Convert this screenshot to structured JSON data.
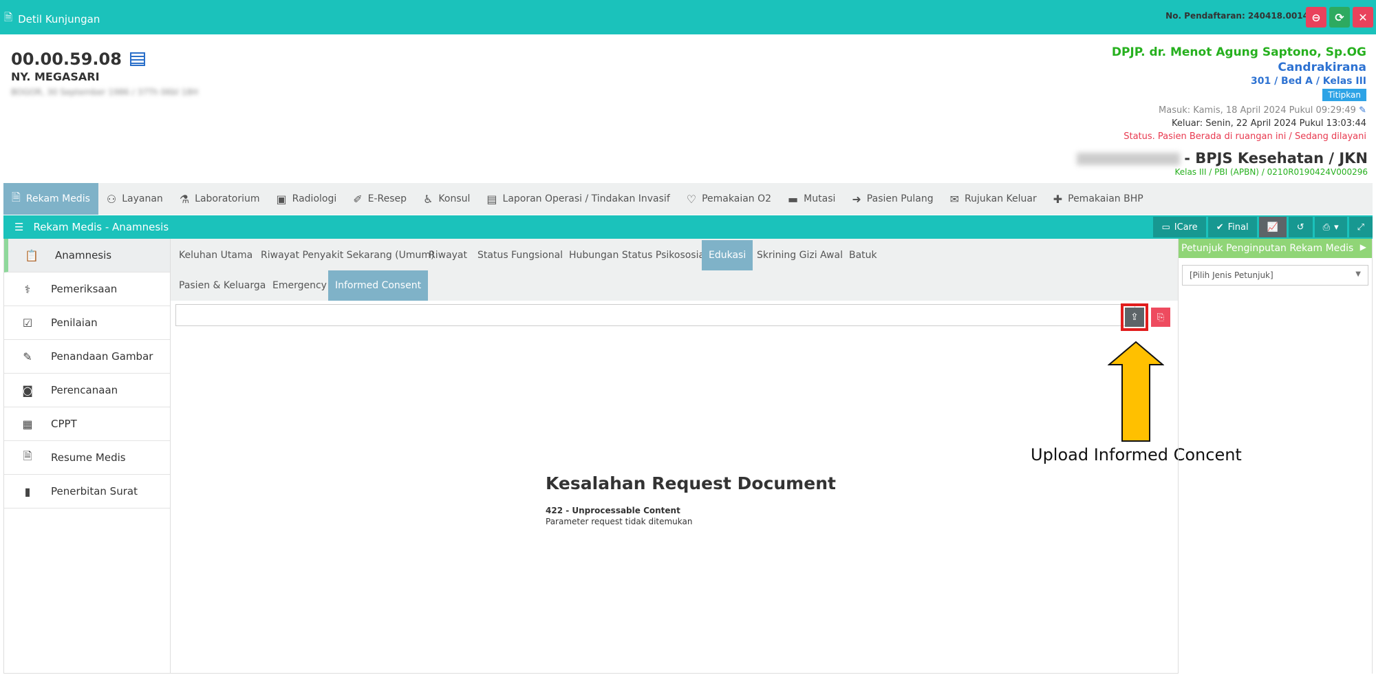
{
  "window": {
    "title": "Detil Kunjungan",
    "registration": "No. Pendaftaran: 240418.0014",
    "btn_min": "⊖",
    "btn_refresh": "⟳",
    "btn_close": "✕"
  },
  "patient": {
    "rm_number": "00.00.59.08",
    "name": "NY. MEGASARI",
    "detail": "BOGOR, 30 September 1986 / 37Th 06bl 18H"
  },
  "doctor": {
    "dpjp": "DPJP. dr. Menot Agung Saptono, Sp.OG",
    "room": "Candrakirana",
    "bed": "301 / Bed A / Kelas III",
    "badge": "Titipkan",
    "masuk": "Masuk: Kamis, 18 April 2024 Pukul 09:29:49",
    "keluar": "Keluar: Senin, 22 April 2024 Pukul 13:03:44",
    "status": "Status. Pasien Berada di ruangan ini / Sedang dilayani"
  },
  "insurance": {
    "main": "- BPJS Kesehatan / JKN",
    "sub": "Kelas III / PBI (APBN) / 0210R0190424V000296"
  },
  "nav": [
    {
      "label": "Rekam Medis",
      "icon": "document-icon"
    },
    {
      "label": "Layanan",
      "icon": "user-icon"
    },
    {
      "label": "Laboratorium",
      "icon": "flask-icon"
    },
    {
      "label": "Radiologi",
      "icon": "xray-icon"
    },
    {
      "label": "E-Resep",
      "icon": "pill-icon"
    },
    {
      "label": "Konsul",
      "icon": "wheelchair-icon"
    },
    {
      "label": "Laporan Operasi / Tindakan Invasif",
      "icon": "newspaper-icon"
    },
    {
      "label": "Pemakaian O2",
      "icon": "heart-icon"
    },
    {
      "label": "Mutasi",
      "icon": "bed-icon"
    },
    {
      "label": "Pasien Pulang",
      "icon": "exit-icon"
    },
    {
      "label": "Rujukan Keluar",
      "icon": "envelope-icon"
    },
    {
      "label": "Pemakaian BHP",
      "icon": "medkit-icon"
    }
  ],
  "panel": {
    "title": "Rekam Medis - Anamnesis",
    "icare": "ICare",
    "final": "Final"
  },
  "sidebar": [
    {
      "label": "Anamnesis"
    },
    {
      "label": "Pemeriksaan"
    },
    {
      "label": "Penilaian"
    },
    {
      "label": "Penandaan Gambar"
    },
    {
      "label": "Perencanaan"
    },
    {
      "label": "CPPT"
    },
    {
      "label": "Resume Medis"
    },
    {
      "label": "Penerbitan Surat"
    }
  ],
  "tabs": [
    {
      "label": "Keluhan Utama"
    },
    {
      "label": "Riwayat Penyakit Sekarang (Umum)"
    },
    {
      "label": "Riwayat"
    },
    {
      "label": "Status Fungsional"
    },
    {
      "label": "Hubungan Status Psikososial"
    },
    {
      "label": "Edukasi"
    },
    {
      "label": "Skrining Gizi Awal"
    },
    {
      "label": "Batuk"
    },
    {
      "label": "Pasien & Keluarga"
    },
    {
      "label": "Emergency"
    },
    {
      "label": "Informed Consent"
    }
  ],
  "error": {
    "title": "Kesalahan Request Document",
    "code": "422 - Unprocessable Content",
    "message": "Parameter request tidak ditemukan"
  },
  "annotation": "Upload Informed Concent",
  "right_panel": {
    "title": "Petunjuk Penginputan Rekam Medis",
    "select_placeholder": "[Pilih Jenis Petunjuk]"
  },
  "colors": {
    "header": "#1bc2bb",
    "active_tab": "#7fb2c8",
    "arrow": "#ffc000",
    "highlight": "#e11d1d"
  }
}
